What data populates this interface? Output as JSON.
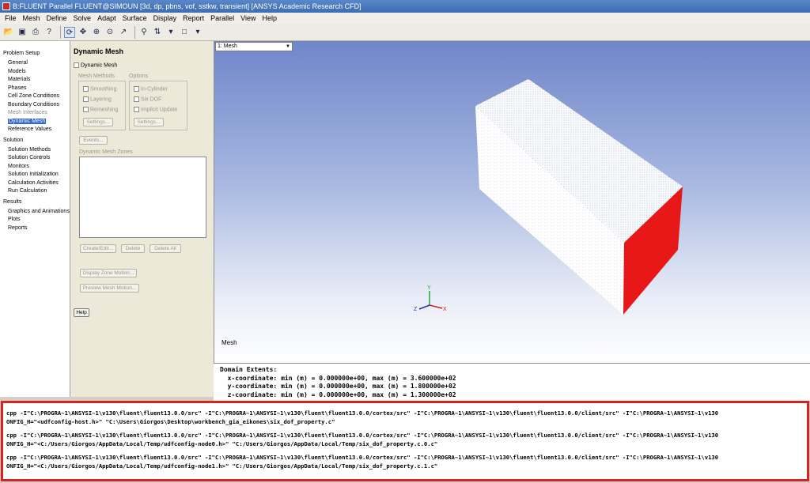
{
  "window": {
    "title": "B:FLUENT Parallel FLUENT@SIMOUN  [3d, dp, pbns, vof, sstkw, transient] [ANSYS Academic Research CFD]"
  },
  "menu": [
    "File",
    "Mesh",
    "Define",
    "Solve",
    "Adapt",
    "Surface",
    "Display",
    "Report",
    "Parallel",
    "View",
    "Help"
  ],
  "tree": {
    "problem_setup": "Problem Setup",
    "general": "General",
    "models": "Models",
    "materials": "Materials",
    "phases": "Phases",
    "cell_zone_conditions": "Cell Zone Conditions",
    "boundary_conditions": "Boundary Conditions",
    "mesh_interfaces": "Mesh Interfaces",
    "dynamic_mesh": "Dynamic Mesh",
    "reference_values": "Reference Values",
    "solution": "Solution",
    "solution_methods": "Solution Methods",
    "solution_controls": "Solution Controls",
    "monitors": "Monitors",
    "solution_initialization": "Solution Initialization",
    "calculation_activities": "Calculation Activities",
    "run_calculation": "Run Calculation",
    "results": "Results",
    "graphics_and_animations": "Graphics and Animations",
    "plots": "Plots",
    "reports": "Reports"
  },
  "task": {
    "title": "Dynamic Mesh",
    "dynamic_mesh_checkbox": "Dynamic Mesh",
    "mesh_methods_label": "Mesh Methods",
    "smoothing": "Smoothing",
    "layering": "Layering",
    "remeshing": "Remeshing",
    "settings_1": "Settings...",
    "options_label": "Options",
    "in_cylinder": "In-Cylinder",
    "six_dof": "Six DOF",
    "implicit_update": "Implicit Update",
    "settings_2": "Settings...",
    "events": "Events...",
    "zones_label": "Dynamic Mesh Zones",
    "create_edit": "Create/Edit...",
    "delete": "Delete",
    "delete_all": "Delete All",
    "display_zone_motion": "Display Zone Motion...",
    "preview_mesh_motion": "Preview Mesh Motion...",
    "help": "Help"
  },
  "graphics": {
    "window_select": "1: Mesh",
    "caption": "Mesh",
    "axes": {
      "x": "X",
      "y": "Y",
      "z": "Z"
    }
  },
  "console": [
    "Domain Extents:",
    "  x-coordinate: min (m) = 0.000000e+00, max (m) = 3.600000e+02",
    "  y-coordinate: min (m) = 0.000000e+00, max (m) = 1.800000e+02",
    "  z-coordinate: min (m) = 0.000000e+00, max (m) = 1.300000e+02"
  ],
  "highlighted_output": [
    "cpp -I\"C:\\PROGRA~1\\ANSYSI~1\\v130\\fluent\\fluent13.0.0/src\" -I\"C:\\PROGRA~1\\ANSYSI~1\\v130\\fluent\\fluent13.0.0/cortex/src\" -I\"C:\\PROGRA~1\\ANSYSI~1\\v130\\fluent\\fluent13.0.0/client/src\" -I\"C:\\PROGRA~1\\ANSYSI~1\\v130",
    "ONFIG_H=\"<udfconfig-host.h>\" \"C:\\Users\\Giorgos\\Desktop\\workbench_gia_eikones\\six_dof_property.c\"",
    "cpp -I\"C:\\PROGRA~1\\ANSYSI~1\\v130\\fluent\\fluent13.0.0/src\" -I\"C:\\PROGRA~1\\ANSYSI~1\\v130\\fluent\\fluent13.0.0/cortex/src\" -I\"C:\\PROGRA~1\\ANSYSI~1\\v130\\fluent\\fluent13.0.0/client/src\" -I\"C:\\PROGRA~1\\ANSYSI~1\\v130",
    "ONFIG_H=\"<C:/Users/Giorgos/AppData/Local/Temp/udfconfig-node0.h>\" \"C:/Users/Giorgos/AppData/Local/Temp/six_dof_property.c.0.c\"",
    "cpp -I\"C:\\PROGRA~1\\ANSYSI~1\\v130\\fluent\\fluent13.0.0/src\" -I\"C:\\PROGRA~1\\ANSYSI~1\\v130\\fluent\\fluent13.0.0/cortex/src\" -I\"C:\\PROGRA~1\\ANSYSI~1\\v130\\fluent\\fluent13.0.0/client/src\" -I\"C:\\PROGRA~1\\ANSYSI~1\\v130",
    "ONFIG_H=\"<C:/Users/Giorgos/AppData/Local/Temp/udfconfig-node1.h>\" \"C:/Users/Giorgos/AppData/Local/Temp/six_dof_property.c.1.c\""
  ],
  "colors": {
    "highlight_border": "#d42424",
    "mesh_face_red": "#e81818",
    "selection_blue": "#3166c8"
  }
}
